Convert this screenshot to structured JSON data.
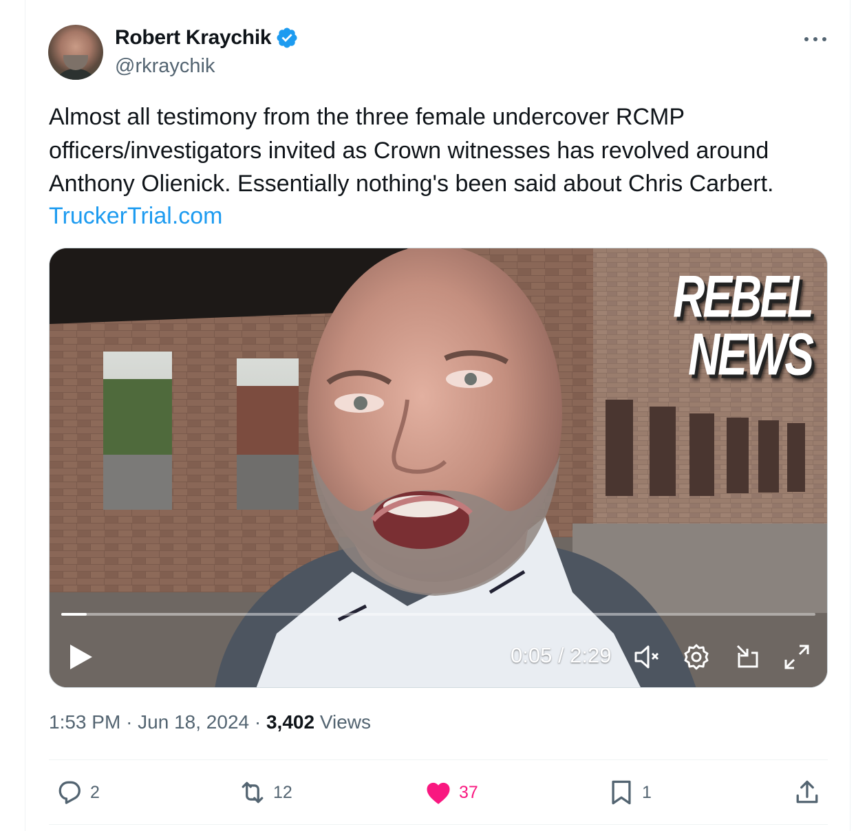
{
  "author": {
    "display_name": "Robert Kraychik",
    "handle": "@rkraychik",
    "verified": true,
    "verified_color": "#1d9bf0"
  },
  "tweet": {
    "text": "Almost all testimony from the three female undercover RCMP officers/investigators invited as Crown witnesses has revolved around Anthony Olienick. Essentially nothing's been said about Chris Carbert.",
    "link_text": "TruckerTrial.com",
    "link_color": "#1d9bf0"
  },
  "video": {
    "overlay_logo_line1": "REBEL",
    "overlay_logo_line2": "NEWS",
    "time_display": "0:05 / 2:29",
    "progress_fraction": 0.034,
    "controls": [
      "play-icon",
      "mute-icon",
      "settings-icon",
      "dock-icon",
      "fullscreen-icon"
    ]
  },
  "meta": {
    "time": "1:53 PM",
    "date": "Jun 18, 2024",
    "views_count": "3,402",
    "views_label": "Views"
  },
  "actions": {
    "replies": "2",
    "reposts": "12",
    "likes": "37",
    "bookmarks": "1",
    "like_color": "#f91880"
  }
}
